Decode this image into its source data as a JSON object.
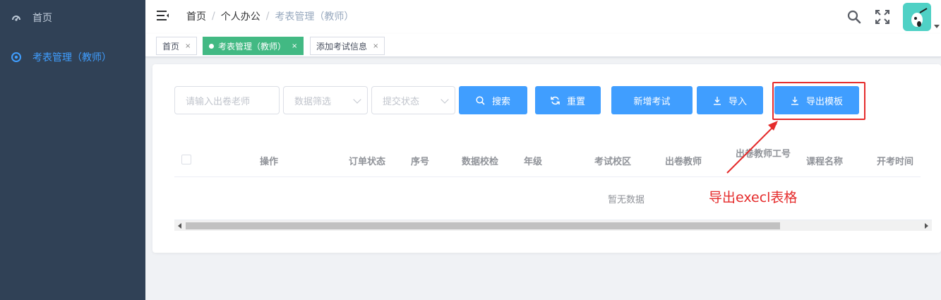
{
  "sidebar": {
    "items": [
      {
        "label": "首页",
        "icon": "dashboard-icon"
      },
      {
        "label": "考表管理（教师）",
        "icon": "chrome-icon"
      }
    ]
  },
  "header": {
    "breadcrumb": [
      "首页",
      "个人办公",
      "考表管理（教师）"
    ],
    "icons": [
      "search-icon",
      "fullscreen-icon"
    ]
  },
  "tags": [
    {
      "label": "首页",
      "close": "×"
    },
    {
      "label": "考表管理（教师）",
      "close": "×"
    },
    {
      "label": "添加考试信息",
      "close": "×"
    }
  ],
  "filters": {
    "teacher_placeholder": "请输入出卷老师",
    "data_filter_placeholder": "数据筛选",
    "submit_status_placeholder": "提交状态"
  },
  "buttons": {
    "search": "搜索",
    "reset": "重置",
    "add_exam": "新增考试",
    "import": "导入",
    "export_template": "导出模板"
  },
  "table": {
    "columns": [
      "操作",
      "订单状态",
      "序号",
      "数据校检",
      "年级",
      "考试校区",
      "出卷教师",
      "出卷教师工号",
      "课程名称",
      "开考时间"
    ],
    "empty_text": "暂无数据"
  },
  "annotation": {
    "text": "导出execl表格",
    "color": "#e52b2b"
  },
  "colors": {
    "sidebar_bg": "#304156",
    "primary": "#409eff",
    "tag_active": "#42b983"
  }
}
